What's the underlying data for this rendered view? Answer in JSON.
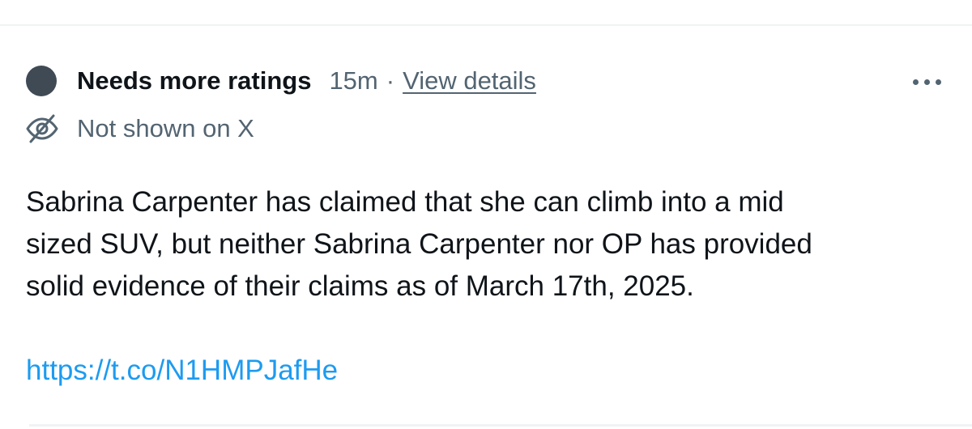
{
  "note": {
    "status_label": "Needs more ratings",
    "status_icon": "status-dot-icon",
    "time": "15m",
    "separator": "·",
    "view_details": "View details",
    "more_icon": "more-horizontal-icon",
    "visibility_icon": "eye-slash-icon",
    "visibility_label": "Not shown on X",
    "text_lines": [
      "Sabrina Carpenter has claimed that she can climb into a mid",
      "sized SUV, but neither Sabrina Carpenter nor OP has provided",
      "solid evidence of their claims as of March 17th, 2025."
    ],
    "link": "https://t.co/N1HMPJafHe"
  },
  "colors": {
    "primary_text": "#0f1419",
    "secondary_text": "#536471",
    "link": "#1d9bf0",
    "status_dot": "#3f4a55",
    "divider": "#eff3f4"
  }
}
